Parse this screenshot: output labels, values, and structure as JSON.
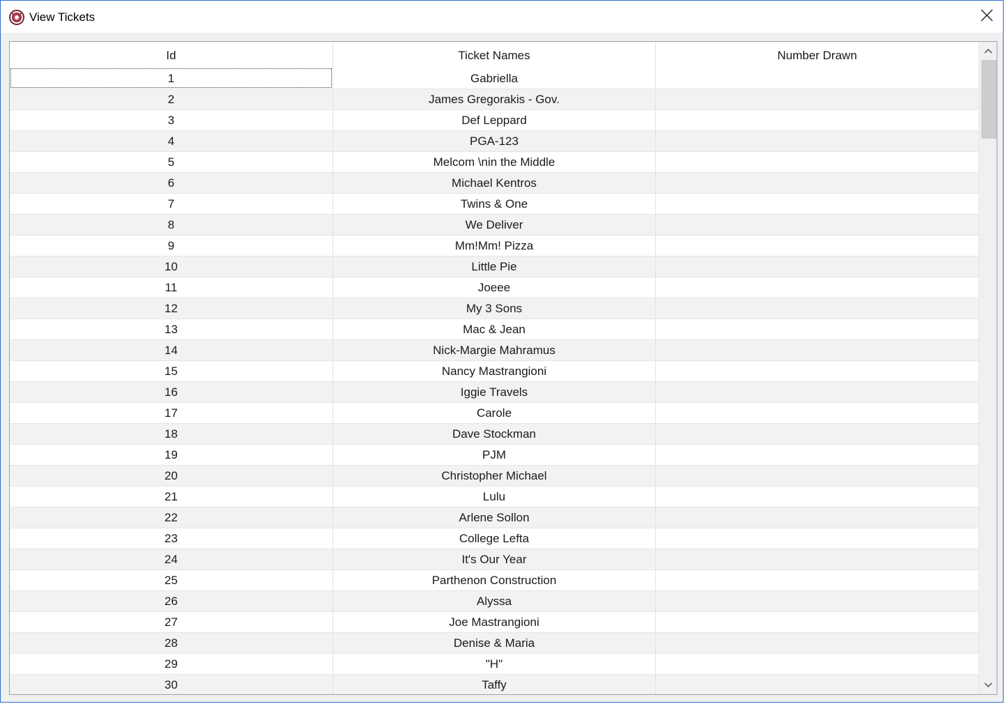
{
  "window": {
    "title": "View Tickets"
  },
  "icons": {
    "app": "app-logo-icon",
    "close": "close-icon",
    "scroll_up": "scroll-up-arrow-icon",
    "scroll_down": "scroll-down-arrow-icon"
  },
  "table": {
    "columns": [
      "Id",
      "Ticket Names",
      "Number Drawn"
    ],
    "rows": [
      {
        "id": "1",
        "name": "Gabriella",
        "drawn": ""
      },
      {
        "id": "2",
        "name": "James Gregorakis - Gov.",
        "drawn": ""
      },
      {
        "id": "3",
        "name": "Def Leppard",
        "drawn": ""
      },
      {
        "id": "4",
        "name": "PGA-123",
        "drawn": ""
      },
      {
        "id": "5",
        "name": "Melcom \\nin the Middle",
        "drawn": ""
      },
      {
        "id": "6",
        "name": "Michael Kentros",
        "drawn": ""
      },
      {
        "id": "7",
        "name": "Twins & One",
        "drawn": ""
      },
      {
        "id": "8",
        "name": "We Deliver",
        "drawn": ""
      },
      {
        "id": "9",
        "name": "Mm!Mm! Pizza",
        "drawn": ""
      },
      {
        "id": "10",
        "name": "Little Pie",
        "drawn": ""
      },
      {
        "id": "11",
        "name": "Joeee",
        "drawn": ""
      },
      {
        "id": "12",
        "name": "My 3 Sons",
        "drawn": ""
      },
      {
        "id": "13",
        "name": "Mac & Jean",
        "drawn": ""
      },
      {
        "id": "14",
        "name": "Nick-Margie Mahramus",
        "drawn": ""
      },
      {
        "id": "15",
        "name": "Nancy Mastrangioni",
        "drawn": ""
      },
      {
        "id": "16",
        "name": "Iggie Travels",
        "drawn": ""
      },
      {
        "id": "17",
        "name": "Carole",
        "drawn": ""
      },
      {
        "id": "18",
        "name": "Dave Stockman",
        "drawn": ""
      },
      {
        "id": "19",
        "name": "PJM",
        "drawn": ""
      },
      {
        "id": "20",
        "name": "Christopher Michael",
        "drawn": ""
      },
      {
        "id": "21",
        "name": "Lulu",
        "drawn": ""
      },
      {
        "id": "22",
        "name": "Arlene Sollon",
        "drawn": ""
      },
      {
        "id": "23",
        "name": "College Lefta",
        "drawn": ""
      },
      {
        "id": "24",
        "name": "It's Our Year",
        "drawn": ""
      },
      {
        "id": "25",
        "name": "Parthenon Construction",
        "drawn": ""
      },
      {
        "id": "26",
        "name": "Alyssa",
        "drawn": ""
      },
      {
        "id": "27",
        "name": "Joe Mastrangioni",
        "drawn": ""
      },
      {
        "id": "28",
        "name": "Denise & Maria",
        "drawn": ""
      },
      {
        "id": "29",
        "name": "\"H\"",
        "drawn": ""
      },
      {
        "id": "30",
        "name": "Taffy",
        "drawn": ""
      }
    ]
  },
  "colors": {
    "window_border": "#2b6bd6",
    "alt_row": "#f2f2f2",
    "scroll_thumb": "#cdcdcd"
  }
}
